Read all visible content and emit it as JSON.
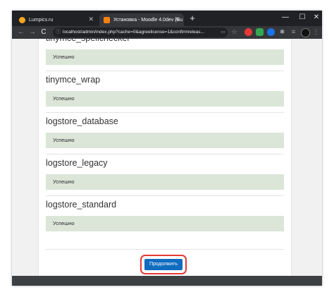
{
  "browser": {
    "tabs": [
      {
        "title": "Lumpics.ru",
        "favicon_color": "#f6a623"
      },
      {
        "title": "Установка - Moodle 4.0dev (Bu",
        "favicon_color": "#f98012"
      }
    ],
    "new_tab": "+",
    "window_controls": {
      "minimize": "—",
      "maximize": "☐",
      "close": "✕"
    },
    "tab_close": "✕",
    "nav": {
      "back": "←",
      "forward": "→",
      "reload": "C"
    },
    "url": "localhost/admin/index.php?cache=0&agreelicense=1&confirmreleas..."
  },
  "plugins": [
    {
      "name": "tinymce_spellchecker",
      "status": "Успешно"
    },
    {
      "name": "tinymce_wrap",
      "status": "Успешно"
    },
    {
      "name": "logstore_database",
      "status": "Успешно"
    },
    {
      "name": "logstore_legacy",
      "status": "Успешно"
    },
    {
      "name": "logstore_standard",
      "status": "Успешно"
    }
  ],
  "continue_label": "Продолжить",
  "colors": {
    "accent": "#0f6cbf",
    "highlight": "#e53935",
    "success_bg": "#dbe6d9"
  }
}
